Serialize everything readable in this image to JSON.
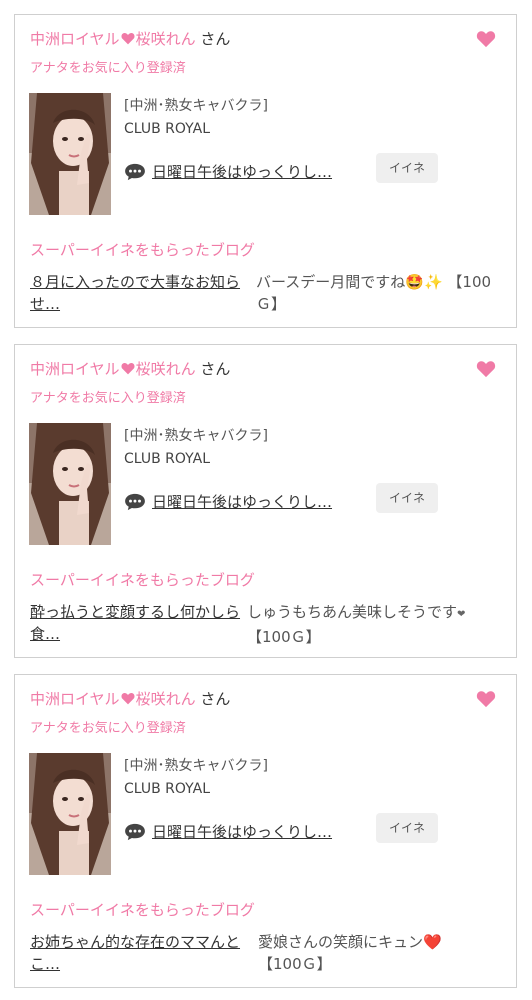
{
  "colors": {
    "accent_pink": "#f07aa6",
    "heart_red": "#e53935",
    "button_bg": "#efefef",
    "card_border": "#cfcfcf"
  },
  "icons": [
    "heart-icon",
    "speech-bubble-icon",
    "star-struck-emoji",
    "sparkles-emoji",
    "small-heart-emoji",
    "red-heart-emoji"
  ],
  "cards": [
    {
      "cast_name_prefix": "中洲ロイヤル",
      "cast_name_suffix": "桜咲れん",
      "honorific": "さん",
      "favorite_status": "アナタをお気に入り登録済",
      "shop_genre": "[中洲･熟女キャバクラ]",
      "shop_name": "CLUB ROYAL",
      "latest_blog_title": "日曜日午後はゆっくりし…",
      "iine_label": "イイネ",
      "super_iine_label": "スーパーイイネをもらったブログ",
      "super_blog_title": "８月に入ったので大事なお知らせ…",
      "super_comment": "バースデー月間ですね",
      "super_comment_emoji": "🤩✨",
      "super_comment_amount": "【100Ｇ】"
    },
    {
      "cast_name_prefix": "中洲ロイヤル",
      "cast_name_suffix": "桜咲れん",
      "honorific": "さん",
      "favorite_status": "アナタをお気に入り登録済",
      "shop_genre": "[中洲･熟女キャバクラ]",
      "shop_name": "CLUB ROYAL",
      "latest_blog_title": "日曜日午後はゆっくりし…",
      "iine_label": "イイネ",
      "super_iine_label": "スーパーイイネをもらったブログ",
      "super_blog_title": "酔っ払うと変顔するし何かしら食…",
      "super_comment": "しゅうもちあん美味しそうです",
      "super_comment_emoji": "❤",
      "super_comment_amount": "【100Ｇ】"
    },
    {
      "cast_name_prefix": "中洲ロイヤル",
      "cast_name_suffix": "桜咲れん",
      "honorific": "さん",
      "favorite_status": "アナタをお気に入り登録済",
      "shop_genre": "[中洲･熟女キャバクラ]",
      "shop_name": "CLUB ROYAL",
      "latest_blog_title": "日曜日午後はゆっくりし…",
      "iine_label": "イイネ",
      "super_iine_label": "スーパーイイネをもらったブログ",
      "super_blog_title": "お姉ちゃん的な存在のママんとこ…",
      "super_comment": "愛娘さんの笑顔にキュン",
      "super_comment_emoji": "❤️",
      "super_comment_amount": "【100Ｇ】"
    }
  ]
}
